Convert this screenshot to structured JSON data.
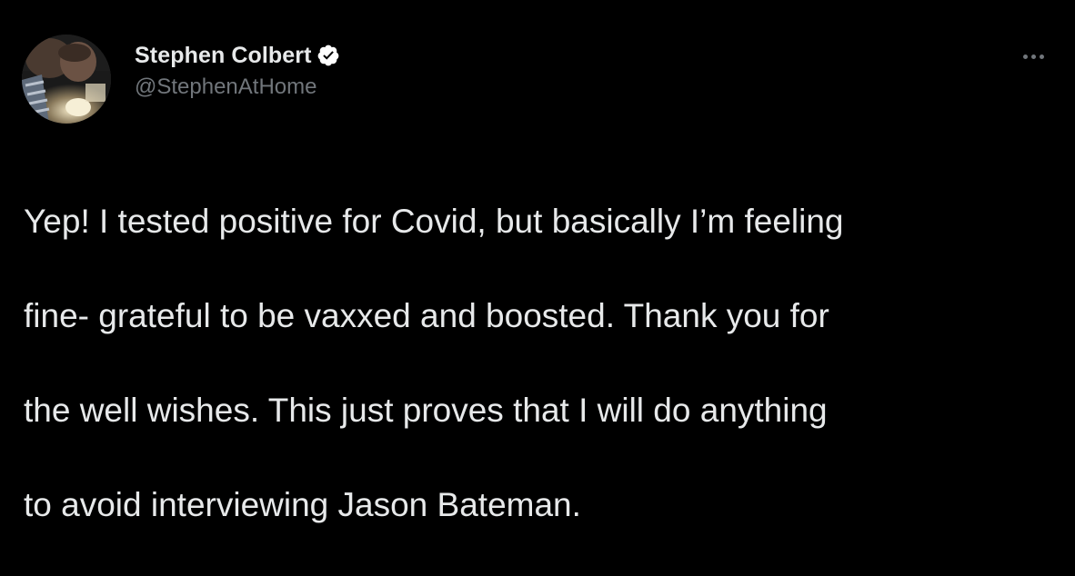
{
  "author": {
    "display_name": "Stephen Colbert",
    "handle": "@StephenAtHome",
    "verified": true,
    "avatar_icon": "profile-photo"
  },
  "menu": {
    "icon": "more-horizontal-icon"
  },
  "tweet": {
    "lines": [
      "Yep! I tested positive for Covid, but basically I’m feeling",
      "fine- grateful to be vaxxed and boosted. Thank you for",
      "the well wishes. This just proves that I will do anything",
      "to avoid interviewing Jason Bateman."
    ]
  },
  "colors": {
    "background": "#000000",
    "primary_text": "#e7e9ea",
    "secondary_text": "#71767b",
    "verified_badge": "#ffffff"
  }
}
